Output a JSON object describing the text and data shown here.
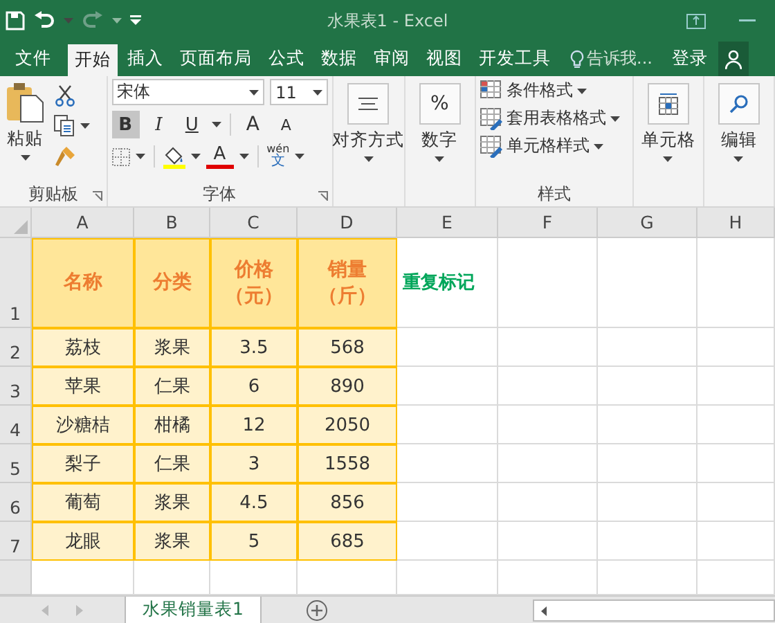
{
  "window": {
    "title": "水果表1 - Excel"
  },
  "tabs": [
    {
      "label": "文件",
      "selected": false
    },
    {
      "label": "开始",
      "selected": true
    },
    {
      "label": "插入",
      "selected": false
    },
    {
      "label": "页面布局",
      "selected": false
    },
    {
      "label": "公式",
      "selected": false
    },
    {
      "label": "数据",
      "selected": false
    },
    {
      "label": "审阅",
      "selected": false
    },
    {
      "label": "视图",
      "selected": false
    },
    {
      "label": "开发工具",
      "selected": false
    }
  ],
  "tell_me": "告诉我...",
  "sign_in": "登录",
  "clipboard": {
    "paste": "粘贴",
    "label": "剪贴板"
  },
  "font": {
    "name": "宋体",
    "size": "11",
    "bold": "B",
    "bold_on": true,
    "italic": "I",
    "underline": "U",
    "grow": "A",
    "shrink": "A",
    "font_color": "A",
    "phonetic_top": "wén",
    "phonetic_bottom": "文",
    "label": "字体"
  },
  "alignment": {
    "label": "对齐方式"
  },
  "number": {
    "symbol": "%",
    "label": "数字"
  },
  "styles": {
    "items": [
      "条件格式",
      "套用表格格式",
      "单元格样式"
    ],
    "label": "样式"
  },
  "cells": {
    "label": "单元格"
  },
  "editing": {
    "label": "编辑"
  },
  "sheet": {
    "columns": [
      "A",
      "B",
      "C",
      "D",
      "E",
      "F",
      "G",
      "H"
    ],
    "rows": [
      {
        "number": "1",
        "kind": "header",
        "cells": [
          "名称",
          "分类",
          "价格（元）",
          "销量（斤）"
        ],
        "note": "重复标记"
      },
      {
        "number": "2",
        "kind": "data",
        "cells": [
          "荔枝",
          "浆果",
          "3.5",
          "568"
        ]
      },
      {
        "number": "3",
        "kind": "data",
        "cells": [
          "苹果",
          "仁果",
          "6",
          "890"
        ]
      },
      {
        "number": "4",
        "kind": "data",
        "cells": [
          "沙糖桔",
          "柑橘",
          "12",
          "2050"
        ]
      },
      {
        "number": "5",
        "kind": "data",
        "cells": [
          "梨子",
          "仁果",
          "3",
          "1558"
        ]
      },
      {
        "number": "6",
        "kind": "data",
        "cells": [
          "葡萄",
          "浆果",
          "4.5",
          "856"
        ]
      },
      {
        "number": "7",
        "kind": "data",
        "cells": [
          "龙眼",
          "浆果",
          "5",
          "685"
        ]
      }
    ]
  },
  "sheet_tabs": [
    {
      "label": "水果销量表1",
      "selected": true
    }
  ]
}
